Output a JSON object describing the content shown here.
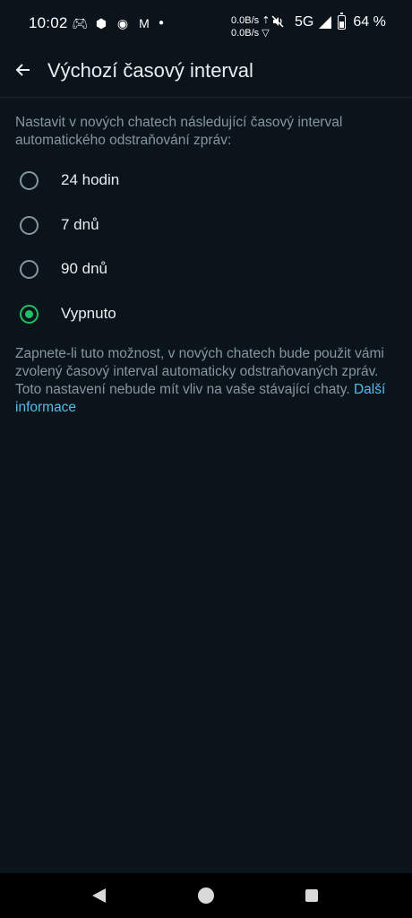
{
  "status_bar": {
    "time": "10:02",
    "net_up": "0.0B/s ⇡",
    "net_down": "0.0B/s ▽",
    "network": "5G",
    "battery": "64 %"
  },
  "app_bar": {
    "title": "Výchozí časový interval"
  },
  "description": "Nastavit v nových chatech následující časový interval automatického odstraňování zpráv:",
  "options": [
    {
      "label": "24 hodin",
      "selected": false
    },
    {
      "label": "7 dnů",
      "selected": false
    },
    {
      "label": "90 dnů",
      "selected": false
    },
    {
      "label": "Vypnuto",
      "selected": true
    }
  ],
  "note": {
    "text": "Zapnete-li tuto možnost, v nových chatech bude použit vámi zvolený časový interval automaticky odstraňovaných zpráv. Toto nastavení nebude mít vliv na vaše stávající chaty.",
    "link": "Další informace"
  },
  "colors": {
    "background": "#0b141a",
    "accent": "#21c063",
    "link": "#53bdeb",
    "secondary_text": "#8696a0"
  }
}
